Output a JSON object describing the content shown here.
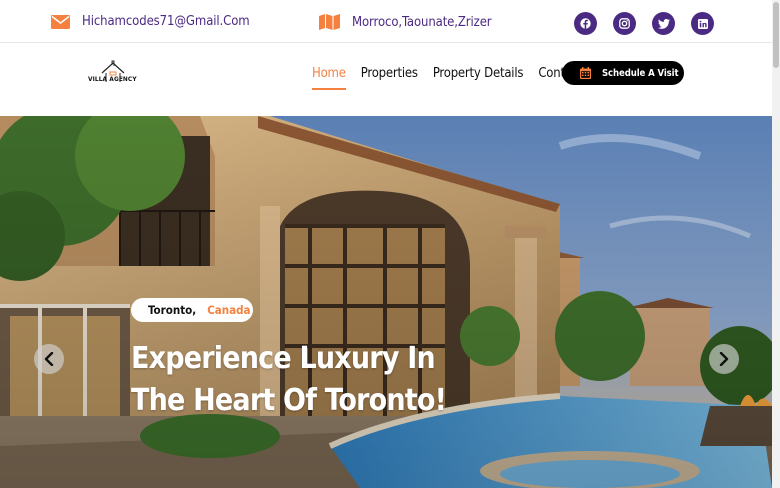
{
  "topbar": {
    "email": "Hichamcodes71@Gmail.Com",
    "email_icon": "envelope-icon",
    "address": "Morroco,Taounate,Zrizer",
    "address_icon": "map-icon",
    "social": [
      "facebook-icon",
      "instagram-icon",
      "twitter-icon",
      "linkedin-icon"
    ]
  },
  "header": {
    "logo_text": "VILLA AGENCY",
    "nav": [
      "Home",
      "Properties",
      "Property Details",
      "Contact"
    ],
    "active_nav": "Home",
    "cta_label": "Schedule A Visit",
    "cta_icon": "calendar-icon"
  },
  "hero": {
    "city": "Toronto,",
    "country": "Canada",
    "title_line1": "Experience Luxury In",
    "title_line2": "The Heart Of Toronto!",
    "prev_icon": "chevron-left-icon",
    "next_icon": "chevron-right-icon"
  },
  "colors": {
    "accent": "#f4813f",
    "brand_purple": "#4b2a83",
    "cta_bg": "#000000"
  }
}
